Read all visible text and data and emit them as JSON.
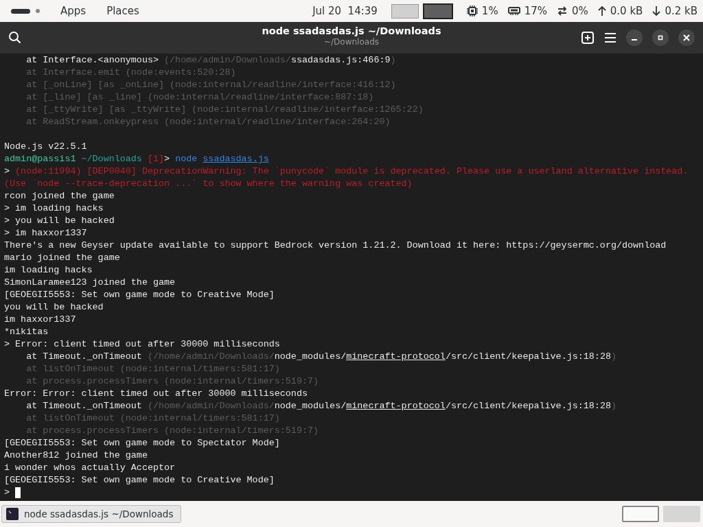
{
  "top_bar": {
    "menus": [
      "Apps",
      "Places"
    ],
    "clock": "Jul 20  14:39",
    "workspaces": [
      {
        "selected": false
      },
      {
        "selected": true
      }
    ],
    "indicators": [
      {
        "kind": "cpu",
        "text": "1%"
      },
      {
        "kind": "memory",
        "text": "17%"
      },
      {
        "kind": "swap",
        "text": "0%"
      },
      {
        "kind": "upload",
        "text": "0.0 kB"
      },
      {
        "kind": "download",
        "text": "0.2 kB"
      }
    ]
  },
  "window": {
    "title": "node ssadasdas.js ~/Downloads",
    "subtitle": "~/Downloads"
  },
  "terminal": {
    "lines": [
      {
        "segments": [
          {
            "kind": "plain",
            "text": "    at Interface.<anonymous> "
          },
          {
            "kind": "dim",
            "text": "(/home/admin/Downloads/"
          },
          {
            "kind": "plain",
            "text": "ssadasdas.js:466:9"
          },
          {
            "kind": "dim",
            "text": ")"
          }
        ]
      },
      {
        "segments": [
          {
            "kind": "dim",
            "text": "    at Interface.emit (node:events:520:28)"
          }
        ]
      },
      {
        "segments": [
          {
            "kind": "dim",
            "text": "    at [_onLine] [as _onLine] (node:internal/readline/interface:416:12)"
          }
        ]
      },
      {
        "segments": [
          {
            "kind": "dim",
            "text": "    at [_line] [as _line] (node:internal/readline/interface:887:18)"
          }
        ]
      },
      {
        "segments": [
          {
            "kind": "dim",
            "text": "    at [_ttyWrite] [as _ttyWrite] (node:internal/readline/interface:1265:22)"
          }
        ]
      },
      {
        "segments": [
          {
            "kind": "dim",
            "text": "    at ReadStream.onkeypress (node:internal/readline/interface:264:20)"
          }
        ]
      },
      {
        "kind": "blank"
      },
      {
        "segments": [
          {
            "kind": "plain",
            "text": "Node.js v22.5.1"
          }
        ]
      },
      {
        "segments": [
          {
            "kind": "user",
            "text": "admin@passis1"
          },
          {
            "kind": "path",
            "text": " ~/Downloads"
          },
          {
            "kind": "error",
            "text": " [1]"
          },
          {
            "kind": "plain",
            "text": "> "
          },
          {
            "kind": "command",
            "text": "node "
          },
          {
            "kind": "commandlink",
            "text": "ssadasdas.js"
          }
        ]
      },
      {
        "segments": [
          {
            "kind": "plain",
            "text": "> "
          },
          {
            "kind": "error",
            "text": "(node:11994) [DEP0040] DeprecationWarning: The `punycode` module is deprecated. Please use a userland alternative instead."
          }
        ]
      },
      {
        "segments": [
          {
            "kind": "error",
            "text": "(Use `node --trace-deprecation ...` to show where the warning was created)"
          }
        ]
      },
      {
        "segments": [
          {
            "kind": "plain",
            "text": "rcon joined the game"
          }
        ]
      },
      {
        "segments": [
          {
            "kind": "plain",
            "text": "> im loading hacks"
          }
        ]
      },
      {
        "segments": [
          {
            "kind": "plain",
            "text": "> you will be hacked"
          }
        ]
      },
      {
        "segments": [
          {
            "kind": "plain",
            "text": "> im haxxor1337"
          }
        ]
      },
      {
        "segments": [
          {
            "kind": "plain",
            "text": "There's a new Geyser update available to support Bedrock version 1.21.2. Download it here: https://geysermc.org/download"
          }
        ]
      },
      {
        "segments": [
          {
            "kind": "plain",
            "text": "mario joined the game"
          }
        ]
      },
      {
        "segments": [
          {
            "kind": "plain",
            "text": "im loading hacks"
          }
        ]
      },
      {
        "segments": [
          {
            "kind": "plain",
            "text": "SimonLaramee123 joined the game"
          }
        ]
      },
      {
        "segments": [
          {
            "kind": "plain",
            "text": "[GEOEGII5553: Set own game mode to Creative Mode]"
          }
        ]
      },
      {
        "segments": [
          {
            "kind": "plain",
            "text": "you will be hacked"
          }
        ]
      },
      {
        "segments": [
          {
            "kind": "plain",
            "text": "im haxxor1337"
          }
        ]
      },
      {
        "segments": [
          {
            "kind": "plain",
            "text": "*nikitas"
          }
        ]
      },
      {
        "segments": [
          {
            "kind": "plain",
            "text": "> Error: client timed out after 30000 milliseconds"
          }
        ]
      },
      {
        "segments": [
          {
            "kind": "plain",
            "text": "    at Timeout._onTimeout "
          },
          {
            "kind": "dim",
            "text": "(/home/admin/Downloads/"
          },
          {
            "kind": "plain",
            "text": "node_modules/"
          },
          {
            "kind": "link",
            "text": "minecraft-protocol"
          },
          {
            "kind": "plain",
            "text": "/src/client/keepalive.js:18:28"
          },
          {
            "kind": "dim",
            "text": ")"
          }
        ]
      },
      {
        "segments": [
          {
            "kind": "dim",
            "text": "    at listOnTimeout (node:internal/timers:581:17)"
          }
        ]
      },
      {
        "segments": [
          {
            "kind": "dim",
            "text": "    at process.processTimers (node:internal/timers:519:7)"
          }
        ]
      },
      {
        "segments": [
          {
            "kind": "plain",
            "text": "Error: Error: client timed out after 30000 milliseconds"
          }
        ]
      },
      {
        "segments": [
          {
            "kind": "plain",
            "text": "    at Timeout._onTimeout "
          },
          {
            "kind": "dim",
            "text": "(/home/admin/Downloads/"
          },
          {
            "kind": "plain",
            "text": "node_modules/"
          },
          {
            "kind": "link",
            "text": "minecraft-protocol"
          },
          {
            "kind": "plain",
            "text": "/src/client/keepalive.js:18:28"
          },
          {
            "kind": "dim",
            "text": ")"
          }
        ]
      },
      {
        "segments": [
          {
            "kind": "dim",
            "text": "    at listOnTimeout (node:internal/timers:581:17)"
          }
        ]
      },
      {
        "segments": [
          {
            "kind": "dim",
            "text": "    at process.processTimers (node:internal/timers:519:7)"
          }
        ]
      },
      {
        "segments": [
          {
            "kind": "plain",
            "text": "[GEOEGII5553: Set own game mode to Spectator Mode]"
          }
        ]
      },
      {
        "segments": [
          {
            "kind": "plain",
            "text": "Another812 joined the game"
          }
        ]
      },
      {
        "segments": [
          {
            "kind": "plain",
            "text": "i wonder whos actually Acceptor"
          }
        ]
      },
      {
        "segments": [
          {
            "kind": "plain",
            "text": "[GEOEGII5553: Set own game mode to Creative Mode]"
          }
        ]
      }
    ],
    "prompt": ">"
  },
  "taskbar": {
    "tasks": [
      {
        "label": "node ssadasdas.js ~/Downloads",
        "selected": true
      }
    ],
    "workspaces": [
      {
        "selected": true
      },
      {
        "selected": false
      }
    ]
  }
}
